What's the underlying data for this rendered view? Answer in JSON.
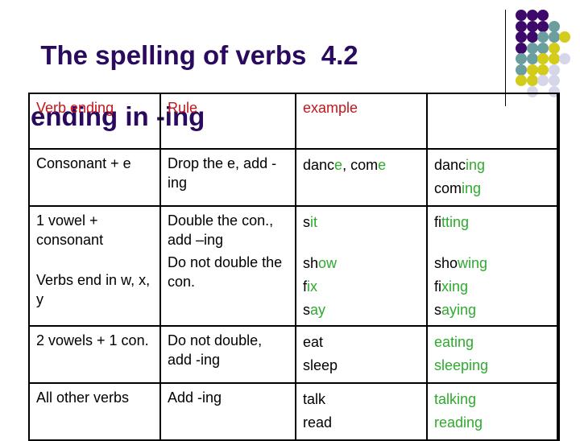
{
  "title": {
    "line1": "The spelling of verbs  4.2",
    "line2": "ending in -ing"
  },
  "colors": {
    "title": "#2a0a5e",
    "header_text": "#c0161c",
    "ending_highlight": "#2eaa2e",
    "dot_purple": "#3d0a6b",
    "dot_teal": "#6b9e9e",
    "dot_yellow": "#d4cc1a",
    "dot_lavender": "#d6d6ea"
  },
  "table": {
    "headers": [
      "Verb ending",
      "Rule",
      "example",
      ""
    ],
    "rows": [
      {
        "ending": [
          "Consonant + e"
        ],
        "rule": [
          "Drop the e, add -ing"
        ],
        "examples": [
          [
            {
              "t": "danc",
              "g": false
            },
            {
              "t": "e",
              "g": true
            },
            {
              "t": ", com",
              "g": false
            },
            {
              "t": "e",
              "g": true
            }
          ]
        ],
        "results": [
          [
            {
              "t": "danc",
              "g": false
            },
            {
              "t": "ing",
              "g": true
            }
          ],
          [
            {
              "t": "com",
              "g": false
            },
            {
              "t": "ing",
              "g": true
            }
          ]
        ]
      },
      {
        "ending": [
          "1 vowel + consonant",
          "Verbs end in w, x, y"
        ],
        "rule": [
          "Double the con., add –ing",
          "Do not double the con."
        ],
        "examples": [
          [
            {
              "t": "s",
              "g": false
            },
            {
              "t": "it",
              "g": true
            }
          ],
          [
            {
              "t": "sh",
              "g": false
            },
            {
              "t": "ow",
              "g": true
            }
          ],
          [
            {
              "t": "f",
              "g": false
            },
            {
              "t": "ix",
              "g": true
            }
          ],
          [
            {
              "t": "s",
              "g": false
            },
            {
              "t": "ay",
              "g": true
            }
          ]
        ],
        "results": [
          [
            {
              "t": "fi",
              "g": false
            },
            {
              "t": "tting",
              "g": true
            }
          ],
          [
            {
              "t": "sho",
              "g": false
            },
            {
              "t": "wing",
              "g": true
            }
          ],
          [
            {
              "t": "fi",
              "g": false
            },
            {
              "t": "xing",
              "g": true
            }
          ],
          [
            {
              "t": "s",
              "g": false
            },
            {
              "t": "aying",
              "g": true
            }
          ]
        ]
      },
      {
        "ending": [
          "2 vowels + 1 con."
        ],
        "rule": [
          "Do not double, add -ing"
        ],
        "examples": [
          [
            {
              "t": "eat",
              "g": false
            }
          ],
          [
            {
              "t": "sleep",
              "g": false
            }
          ]
        ],
        "results": [
          [
            {
              "t": "eating",
              "g": true
            }
          ],
          [
            {
              "t": "sleeping",
              "g": true
            }
          ]
        ]
      },
      {
        "ending": [
          "All other verbs"
        ],
        "rule": [
          "Add -ing"
        ],
        "examples": [
          [
            {
              "t": "talk",
              "g": false
            }
          ],
          [
            {
              "t": "read",
              "g": false
            }
          ]
        ],
        "results": [
          [
            {
              "t": "talking",
              "g": true
            }
          ],
          [
            {
              "t": "reading",
              "g": true
            }
          ]
        ]
      }
    ]
  },
  "decoration": {
    "dot_grid": [
      [
        "purple",
        "purple",
        "purple",
        null,
        null
      ],
      [
        "purple",
        "purple",
        "purple",
        "teal",
        null
      ],
      [
        "purple",
        "purple",
        "teal",
        "teal",
        "yellow"
      ],
      [
        "purple",
        "teal",
        "teal",
        "yellow",
        null
      ],
      [
        "teal",
        "teal",
        "yellow",
        "yellow",
        "lavender"
      ],
      [
        "teal",
        "yellow",
        "yellow",
        "lavender",
        null
      ],
      [
        "yellow",
        "yellow",
        "lavender",
        "lavender",
        null
      ],
      [
        null,
        "lavender",
        null,
        "lavender",
        null
      ]
    ]
  }
}
